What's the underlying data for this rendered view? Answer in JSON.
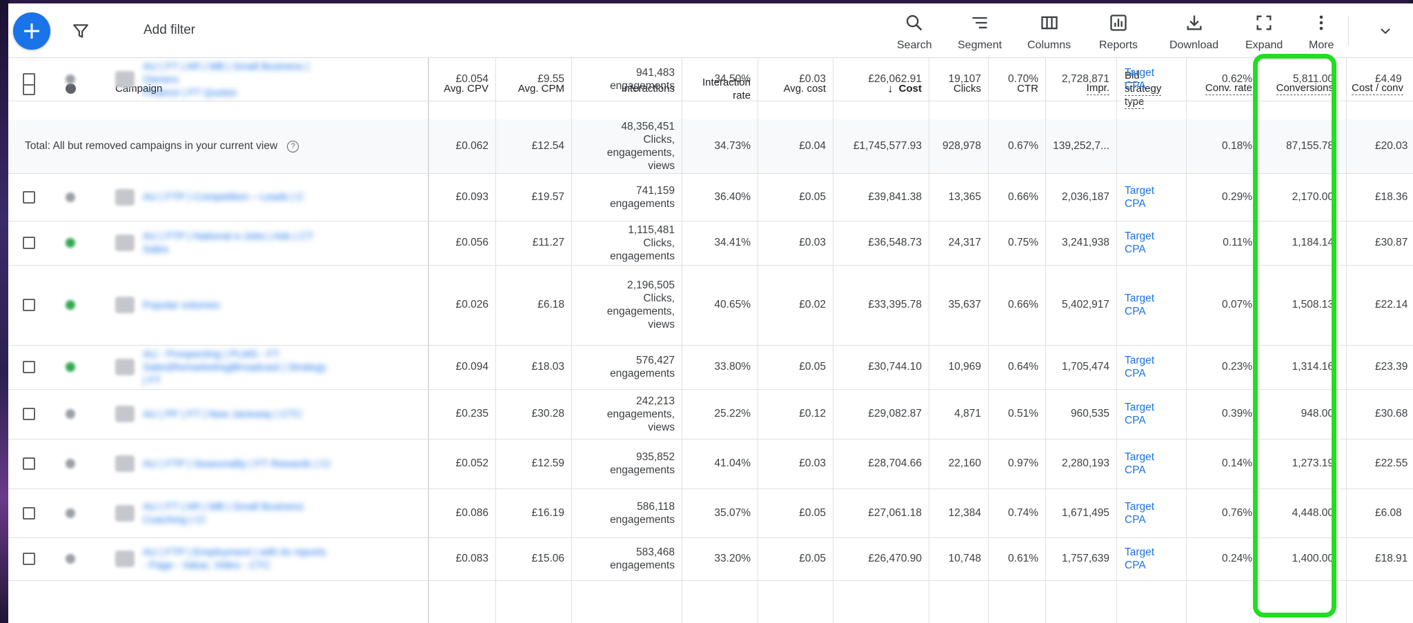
{
  "toolbar": {
    "add_filter": "Add filter",
    "buttons": [
      {
        "label": "Search",
        "icon": "search-icon"
      },
      {
        "label": "Segment",
        "icon": "segment-icon"
      },
      {
        "label": "Columns",
        "icon": "columns-icon"
      },
      {
        "label": "Reports",
        "icon": "reports-icon"
      },
      {
        "label": "Download",
        "icon": "download-icon"
      },
      {
        "label": "Expand",
        "icon": "expand-icon"
      },
      {
        "label": "More",
        "icon": "more-vert-icon"
      }
    ]
  },
  "colors": {
    "accent": "#1a73e8",
    "highlight": "#22dd22",
    "status_enabled": "#34a853",
    "status_paused": "#9aa0a6"
  },
  "table": {
    "headers": {
      "campaign": "Campaign",
      "avg_cpv": "Avg. CPV",
      "avg_cpm": "Avg. CPM",
      "interactions": "Interactions",
      "interaction_rate_1": "Interaction",
      "interaction_rate_2": "rate",
      "avg_cost": "Avg. cost",
      "cost": "Cost",
      "clicks": "Clicks",
      "ctr": "CTR",
      "impr": "Impr.",
      "bid_1": "Bid",
      "bid_2": "strategy",
      "bid_3": "type",
      "conv_rate": "Conv. rate",
      "conversions": "Conversions",
      "cost_conv": "Cost / conv"
    },
    "sort": {
      "column": "Cost",
      "direction": "descending"
    },
    "total": {
      "label": "Total: All but removed campaigns in your current view",
      "avg_cpv": "£0.062",
      "avg_cpm": "£12.54",
      "interactions": [
        "48,356,451",
        "Clicks,",
        "engagements,",
        "views"
      ],
      "interaction_rate": "34.73%",
      "avg_cost": "£0.04",
      "cost": "£1,745,577.93",
      "clicks": "928,978",
      "ctr": "0.67%",
      "impr": "139,252,7...",
      "bid": "",
      "conv_rate": "0.18%",
      "conversions": "87,155.78",
      "cost_conv": "£20.03"
    },
    "rows": [
      {
        "name": [
          "AU | FTP | Competition – Leads | C"
        ],
        "status": "paused",
        "avg_cpv": "£0.093",
        "avg_cpm": "£19.57",
        "interactions": [
          "741,159",
          "engagements"
        ],
        "interaction_rate": "36.40%",
        "avg_cost": "£0.05",
        "cost": "£39,841.38",
        "clicks": "13,365",
        "ctr": "0.66%",
        "impr": "2,036,187",
        "bid": [
          "Target",
          "CPA"
        ],
        "conv_rate": "0.29%",
        "conversions": "2,170.00",
        "cost_conv": "£18.36"
      },
      {
        "name": [
          "AU | FTP | National e-Jobs | Ads | CT",
          "Sales"
        ],
        "status": "enabled",
        "avg_cpv": "£0.056",
        "avg_cpm": "£11.27",
        "interactions": [
          "1,115,481",
          "Clicks,",
          "engagements"
        ],
        "interaction_rate": "34.41%",
        "avg_cost": "£0.03",
        "cost": "£36,548.73",
        "clicks": "24,317",
        "ctr": "0.75%",
        "impr": "3,241,938",
        "bid": [
          "Target",
          "CPA"
        ],
        "conv_rate": "0.11%",
        "conversions": "1,184.14",
        "cost_conv": "£30.87"
      },
      {
        "name": [
          "Popular volumes"
        ],
        "status": "enabled",
        "avg_cpv": "£0.026",
        "avg_cpm": "£6.18",
        "interactions": [
          "2,196,505",
          "Clicks,",
          "engagements,",
          "views"
        ],
        "interaction_rate": "40.65%",
        "avg_cost": "£0.02",
        "cost": "£33,395.78",
        "clicks": "35,637",
        "ctr": "0.66%",
        "impr": "5,402,917",
        "bid": [
          "Target",
          "CPA"
        ],
        "conv_rate": "0.07%",
        "conversions": "1,508.13",
        "cost_conv": "£22.14"
      },
      {
        "name": [
          "AU - Prospecting | PLMS - FT",
          "Sales|Remarketing|Broadcast | Strategy",
          "| FT"
        ],
        "status": "enabled",
        "avg_cpv": "£0.094",
        "avg_cpm": "£18.03",
        "interactions": [
          "576,427",
          "engagements"
        ],
        "interaction_rate": "33.80%",
        "avg_cost": "£0.05",
        "cost": "£30,744.10",
        "clicks": "10,969",
        "ctr": "0.64%",
        "impr": "1,705,474",
        "bid": [
          "Target",
          "CPA"
        ],
        "conv_rate": "0.23%",
        "conversions": "1,314.16",
        "cost_conv": "£23.39"
      },
      {
        "name": [
          "AU | PF | FT | New Janeway | CTC"
        ],
        "status": "paused",
        "avg_cpv": "£0.235",
        "avg_cpm": "£30.28",
        "interactions": [
          "242,213",
          "engagements,",
          "views"
        ],
        "interaction_rate": "25.22%",
        "avg_cost": "£0.12",
        "cost": "£29,082.87",
        "clicks": "4,871",
        "ctr": "0.51%",
        "impr": "960,535",
        "bid": [
          "Target",
          "CPA"
        ],
        "conv_rate": "0.39%",
        "conversions": "948.00",
        "cost_conv": "£30.68"
      },
      {
        "name": [
          "AU | FTP | Seasonality | FT Rewards | CI"
        ],
        "status": "paused",
        "avg_cpv": "£0.052",
        "avg_cpm": "£12.59",
        "interactions": [
          "935,852",
          "engagements"
        ],
        "interaction_rate": "41.04%",
        "avg_cost": "£0.03",
        "cost": "£28,704.66",
        "clicks": "22,160",
        "ctr": "0.97%",
        "impr": "2,280,193",
        "bid": [
          "Target",
          "CPA"
        ],
        "conv_rate": "0.14%",
        "conversions": "1,273.19",
        "cost_conv": "£22.55"
      },
      {
        "name": [
          "AU | FT | AR | MB | Small Business",
          "Coaching | CI"
        ],
        "status": "paused",
        "avg_cpv": "£0.086",
        "avg_cpm": "£16.19",
        "interactions": [
          "586,118",
          "engagements"
        ],
        "interaction_rate": "35.07%",
        "avg_cost": "£0.05",
        "cost": "£27,061.18",
        "clicks": "12,384",
        "ctr": "0.74%",
        "impr": "1,671,495",
        "bid": [
          "Target",
          "CPA"
        ],
        "conv_rate": "0.76%",
        "conversions": "4,448.00",
        "cost_conv": "£6.08"
      },
      {
        "name": [
          "AU | FTP | Employment | with its reports",
          "- Page - Value, Video - CTC"
        ],
        "status": "paused",
        "avg_cpv": "£0.083",
        "avg_cpm": "£15.06",
        "interactions": [
          "583,468",
          "engagements"
        ],
        "interaction_rate": "33.20%",
        "avg_cost": "£0.05",
        "cost": "£26,470.90",
        "clicks": "10,748",
        "ctr": "0.61%",
        "impr": "1,757,639",
        "bid": [
          "Target",
          "CPA"
        ],
        "conv_rate": "0.24%",
        "conversions": "1,400.00",
        "cost_conv": "£18.91"
      },
      {
        "name": [
          "AU | FT | AR | MB | Small Business | Owners",
          "Finance | FT Quotes"
        ],
        "status": "paused",
        "avg_cpv": "£0.054",
        "avg_cpm": "£9.55",
        "interactions": [
          "941,483",
          "engagements"
        ],
        "interaction_rate": "34.50%",
        "avg_cost": "£0.03",
        "cost": "£26,062.91",
        "clicks": "19,107",
        "ctr": "0.70%",
        "impr": "2,728,871",
        "bid": [
          "Target",
          "CPA"
        ],
        "conv_rate": "0.62%",
        "conversions": "5,811.00",
        "cost_conv": "£4.49"
      }
    ]
  }
}
